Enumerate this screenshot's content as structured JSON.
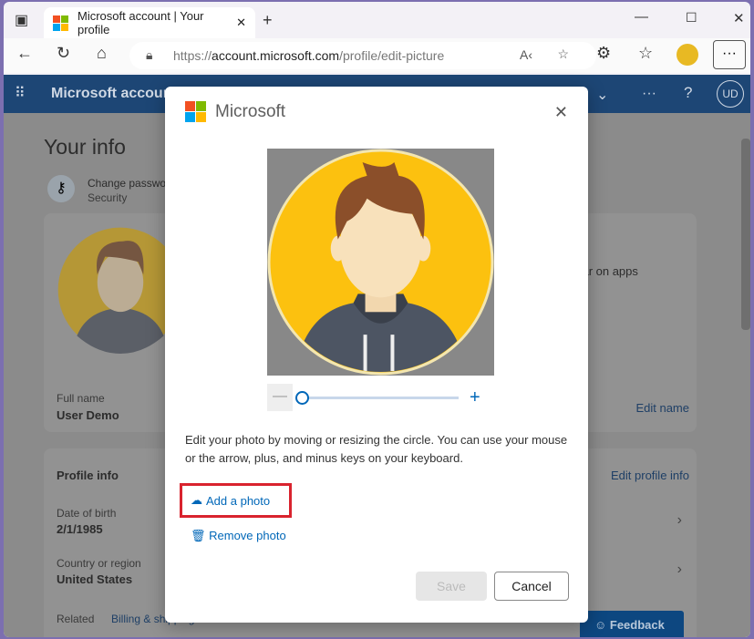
{
  "browser": {
    "tab_title": "Microsoft account | Your profile",
    "url_prefix": "https://",
    "url_domain": "account.microsoft.com",
    "url_path": "/profile/edit-picture"
  },
  "header": {
    "app_title": "Microsoft account",
    "avatar_initials": "UD"
  },
  "page": {
    "title": "Your info",
    "change_password": "Change password",
    "security": "Security",
    "full_name_label": "Full name",
    "full_name": "User Demo",
    "edit_name": "Edit name",
    "appear_text": "pear on apps",
    "profile_info": "Profile info",
    "edit_profile_info": "Edit profile info",
    "dob_label": "Date of birth",
    "dob": "2/1/1985",
    "country_label": "Country or region",
    "country": "United States",
    "related": "Related",
    "billing": "Billing & shipping",
    "feedback": "Feedback"
  },
  "dialog": {
    "brand": "Microsoft",
    "instructions": "Edit your photo by moving or resizing the circle. You can use your mouse or the arrow, plus, and minus keys on your keyboard.",
    "add_photo": "Add a photo",
    "remove_photo": "Remove photo",
    "save": "Save",
    "cancel": "Cancel",
    "zoom_level": 0,
    "highlight_color": "#d9232e"
  },
  "colors": {
    "ms_red": "#f25022",
    "ms_green": "#7fba00",
    "ms_blue": "#00a4ef",
    "ms_yellow": "#ffb900",
    "accent": "#0067b8"
  }
}
